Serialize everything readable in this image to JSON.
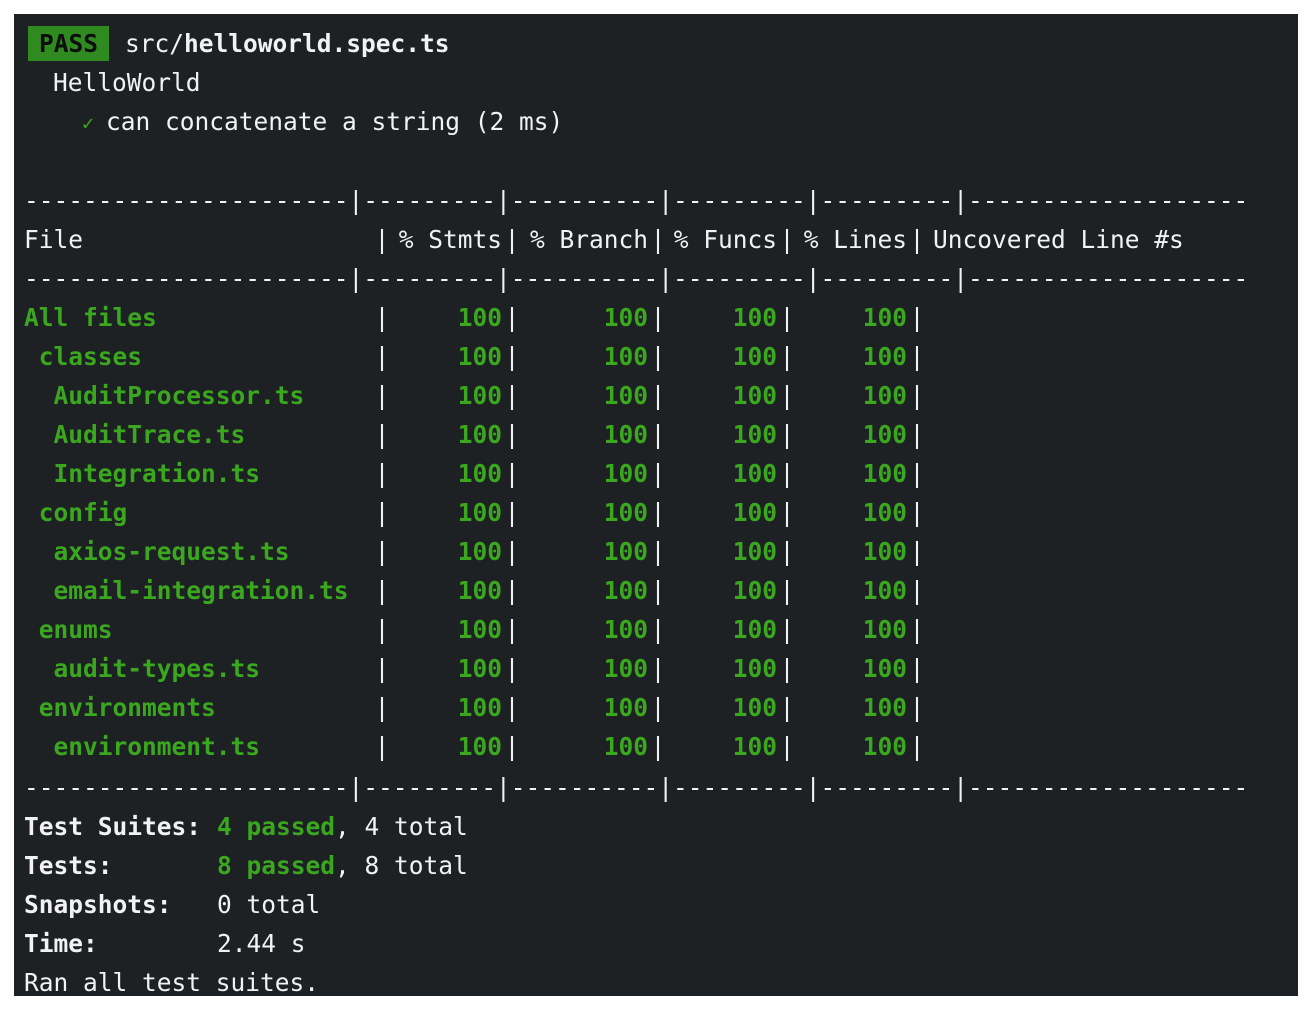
{
  "pass_badge": "PASS",
  "spec_path_prefix": "src/",
  "spec_path_file": "helloworld.spec.ts",
  "describe_name": "HelloWorld",
  "test_check": "✓",
  "test_name": "can concatenate a string (2 ms)",
  "table": {
    "divider": "----------------------|---------|----------|---------|---------|-------------------",
    "headers": [
      "File",
      "% Stmts",
      "% Branch",
      "% Funcs",
      "% Lines",
      "Uncovered Line #s"
    ],
    "rows": [
      {
        "file": "All files",
        "stmts": "100",
        "branch": "100",
        "funcs": "100",
        "lines": "100",
        "uncovered": ""
      },
      {
        "file": " classes",
        "stmts": "100",
        "branch": "100",
        "funcs": "100",
        "lines": "100",
        "uncovered": ""
      },
      {
        "file": "  AuditProcessor.ts",
        "stmts": "100",
        "branch": "100",
        "funcs": "100",
        "lines": "100",
        "uncovered": ""
      },
      {
        "file": "  AuditTrace.ts",
        "stmts": "100",
        "branch": "100",
        "funcs": "100",
        "lines": "100",
        "uncovered": ""
      },
      {
        "file": "  Integration.ts",
        "stmts": "100",
        "branch": "100",
        "funcs": "100",
        "lines": "100",
        "uncovered": ""
      },
      {
        "file": " config",
        "stmts": "100",
        "branch": "100",
        "funcs": "100",
        "lines": "100",
        "uncovered": ""
      },
      {
        "file": "  axios-request.ts",
        "stmts": "100",
        "branch": "100",
        "funcs": "100",
        "lines": "100",
        "uncovered": ""
      },
      {
        "file": "  email-integration.ts",
        "stmts": "100",
        "branch": "100",
        "funcs": "100",
        "lines": "100",
        "uncovered": ""
      },
      {
        "file": " enums",
        "stmts": "100",
        "branch": "100",
        "funcs": "100",
        "lines": "100",
        "uncovered": ""
      },
      {
        "file": "  audit-types.ts",
        "stmts": "100",
        "branch": "100",
        "funcs": "100",
        "lines": "100",
        "uncovered": ""
      },
      {
        "file": " environments",
        "stmts": "100",
        "branch": "100",
        "funcs": "100",
        "lines": "100",
        "uncovered": ""
      },
      {
        "file": "  environment.ts",
        "stmts": "100",
        "branch": "100",
        "funcs": "100",
        "lines": "100",
        "uncovered": ""
      }
    ]
  },
  "summary": {
    "suites_label": "Test Suites:",
    "suites_passed": "4 passed",
    "suites_total": ", 4 total",
    "tests_label": "Tests:",
    "tests_passed": "8 passed",
    "tests_total": ", 8 total",
    "snapshots_label": "Snapshots:",
    "snapshots_value": "0 total",
    "time_label": "Time:",
    "time_value": "2.44 s",
    "ran_all": "Ran all test suites."
  },
  "colors": {
    "background": "#1e2124",
    "text": "#f2f2f2",
    "pass_green": "#3aa71f",
    "badge_bg": "#2f8b1f"
  }
}
